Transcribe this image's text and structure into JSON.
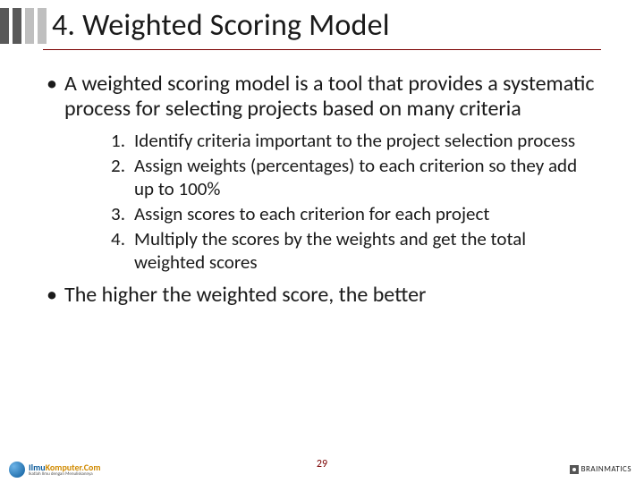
{
  "header": {
    "title": "4. Weighted Scoring Model"
  },
  "bullets": {
    "intro": "A weighted scoring model is a tool that provides a systematic process for selecting projects based on many criteria",
    "closing": "The higher the weighted score, the better"
  },
  "steps": [
    {
      "n": "1.",
      "text": "Identify criteria important to the project selection process"
    },
    {
      "n": "2.",
      "text": "Assign weights (percentages) to each criterion so they add up to 100%"
    },
    {
      "n": "3.",
      "text": "Assign scores to each criterion for each project"
    },
    {
      "n": "4.",
      "text": "Multiply the scores by the weights and get the total weighted scores"
    }
  ],
  "page_number": "29",
  "logo_left": {
    "line1a": "Ilmu",
    "line1b": "Komputer.Com",
    "line2": "Ikatlah Ilmu dengan Menuliskannya"
  },
  "logo_right": {
    "text": "BRAINMATICS"
  }
}
